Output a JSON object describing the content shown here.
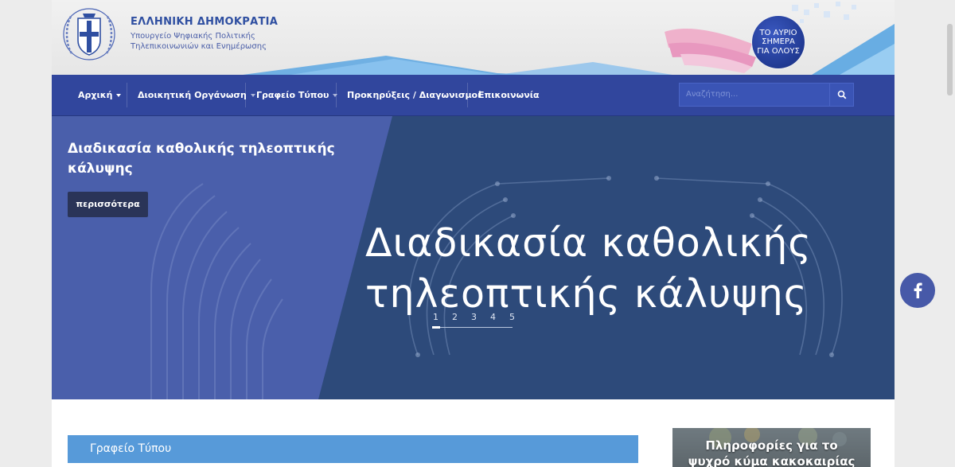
{
  "header": {
    "brand_title": "ΕΛΛΗΝΙΚΗ ΔΗΜΟΚΡΑΤΙΑ",
    "brand_sub_line1": "Υπουργείο Ψηφιακής Πολιτικής",
    "brand_sub_line2": "Τηλεπικοινωνιών και Ενημέρωσης",
    "badge_line1": "ΤΟ ΑΥΡΙΟ",
    "badge_line2": "ΣΗΜΕΡΑ",
    "badge_line3": "ΓΙΑ ΟΛΟΥΣ"
  },
  "nav": {
    "items": [
      {
        "label": "Αρχική"
      },
      {
        "label": "Διοικητική Οργάνωση"
      },
      {
        "label": "Γραφείο Τύπου"
      },
      {
        "label": "Προκηρύξεις / Διαγωνισμοί"
      },
      {
        "label": "Επικοινωνία"
      }
    ],
    "search_placeholder": "Αναζήτηση..."
  },
  "hero": {
    "title": "Διαδικασία καθολικής τηλεοπτικής κάλυψης",
    "more_label": "περισσότερα",
    "big_line1": "Διαδικασία καθολικής",
    "big_line2": "τηλεοπτικής κάλυψης",
    "slides": [
      "1",
      "2",
      "3",
      "4",
      "5"
    ],
    "active_slide": 1
  },
  "main": {
    "press_title": "Γραφείο Τύπου",
    "side_card_line1": "Πληροφορίες για το",
    "side_card_line2": "ψυχρό κύμα κακοκαιρίας"
  },
  "colors": {
    "nav_bg": "#31469d",
    "hero_dark": "#2d4a7a",
    "hero_light": "#4a5fab",
    "press_bar": "#579ad9",
    "brand": "#2f4fa1"
  },
  "icons": [
    "emblem-icon",
    "search-icon",
    "facebook-icon",
    "caret-down-icon"
  ]
}
